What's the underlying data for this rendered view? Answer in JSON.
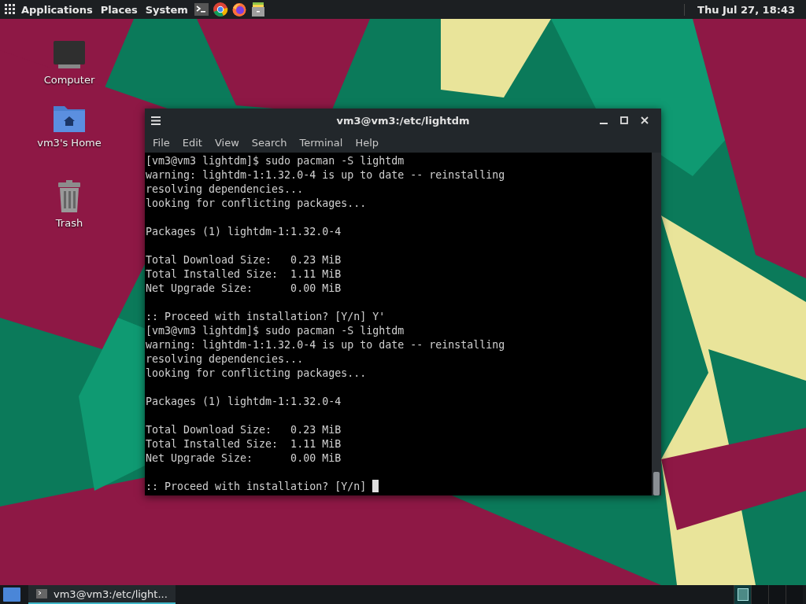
{
  "top_panel": {
    "menus": [
      "Applications",
      "Places",
      "System"
    ],
    "launchers": [
      {
        "kind": "terminal"
      },
      {
        "kind": "chrome"
      },
      {
        "kind": "firefox"
      },
      {
        "kind": "files"
      }
    ],
    "clock": "Thu Jul 27, 18:43"
  },
  "desktop_icons": [
    {
      "kind": "computer",
      "label": "Computer"
    },
    {
      "kind": "home",
      "label": "vm3's Home"
    },
    {
      "kind": "trash",
      "label": "Trash"
    }
  ],
  "terminal": {
    "title": "vm3@vm3:/etc/lightdm",
    "menu": [
      "File",
      "Edit",
      "View",
      "Search",
      "Terminal",
      "Help"
    ],
    "cursor": true,
    "blocks": [
      [
        "[vm3@vm3 lightdm]$ sudo pacman -S lightdm",
        "warning: lightdm-1:1.32.0-4 is up to date -- reinstalling",
        "resolving dependencies...",
        "looking for conflicting packages..."
      ],
      [
        "Packages (1) lightdm-1:1.32.0-4"
      ],
      [
        "Total Download Size:   0.23 MiB",
        "Total Installed Size:  1.11 MiB",
        "Net Upgrade Size:      0.00 MiB"
      ],
      [
        ":: Proceed with installation? [Y/n] Y'",
        "[vm3@vm3 lightdm]$ sudo pacman -S lightdm",
        "warning: lightdm-1:1.32.0-4 is up to date -- reinstalling",
        "resolving dependencies...",
        "looking for conflicting packages..."
      ],
      [
        "Packages (1) lightdm-1:1.32.0-4"
      ],
      [
        "Total Download Size:   0.23 MiB",
        "Total Installed Size:  1.11 MiB",
        "Net Upgrade Size:      0.00 MiB"
      ],
      [
        ":: Proceed with installation? [Y/n] "
      ]
    ]
  },
  "taskbar": {
    "tasks": [
      {
        "label": "vm3@vm3:/etc/light...",
        "selected": true
      }
    ],
    "workspaces": [
      {
        "selected": true
      },
      {
        "selected": false
      },
      {
        "selected": false
      },
      {
        "selected": false
      }
    ]
  }
}
